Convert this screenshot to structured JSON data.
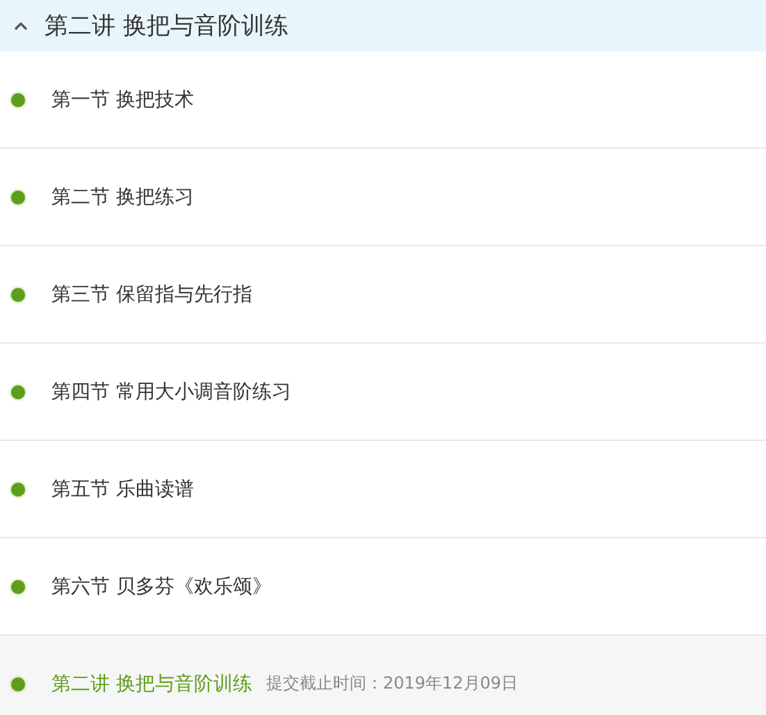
{
  "chapter": {
    "title": "第二讲 换把与音阶训练",
    "expanded": true
  },
  "items": [
    {
      "kind": "lesson",
      "title": "第一节 换把技术"
    },
    {
      "kind": "lesson",
      "title": "第二节 换把练习"
    },
    {
      "kind": "lesson",
      "title": "第三节 保留指与先行指"
    },
    {
      "kind": "lesson",
      "title": "第四节 常用大小调音阶练习"
    },
    {
      "kind": "lesson",
      "title": "第五节 乐曲读谱"
    },
    {
      "kind": "lesson",
      "title": "第六节 贝多芬《欢乐颂》"
    },
    {
      "kind": "assignment",
      "title": "第二讲 换把与音阶训练",
      "deadline": "提交截止时间：2019年12月09日"
    }
  ]
}
